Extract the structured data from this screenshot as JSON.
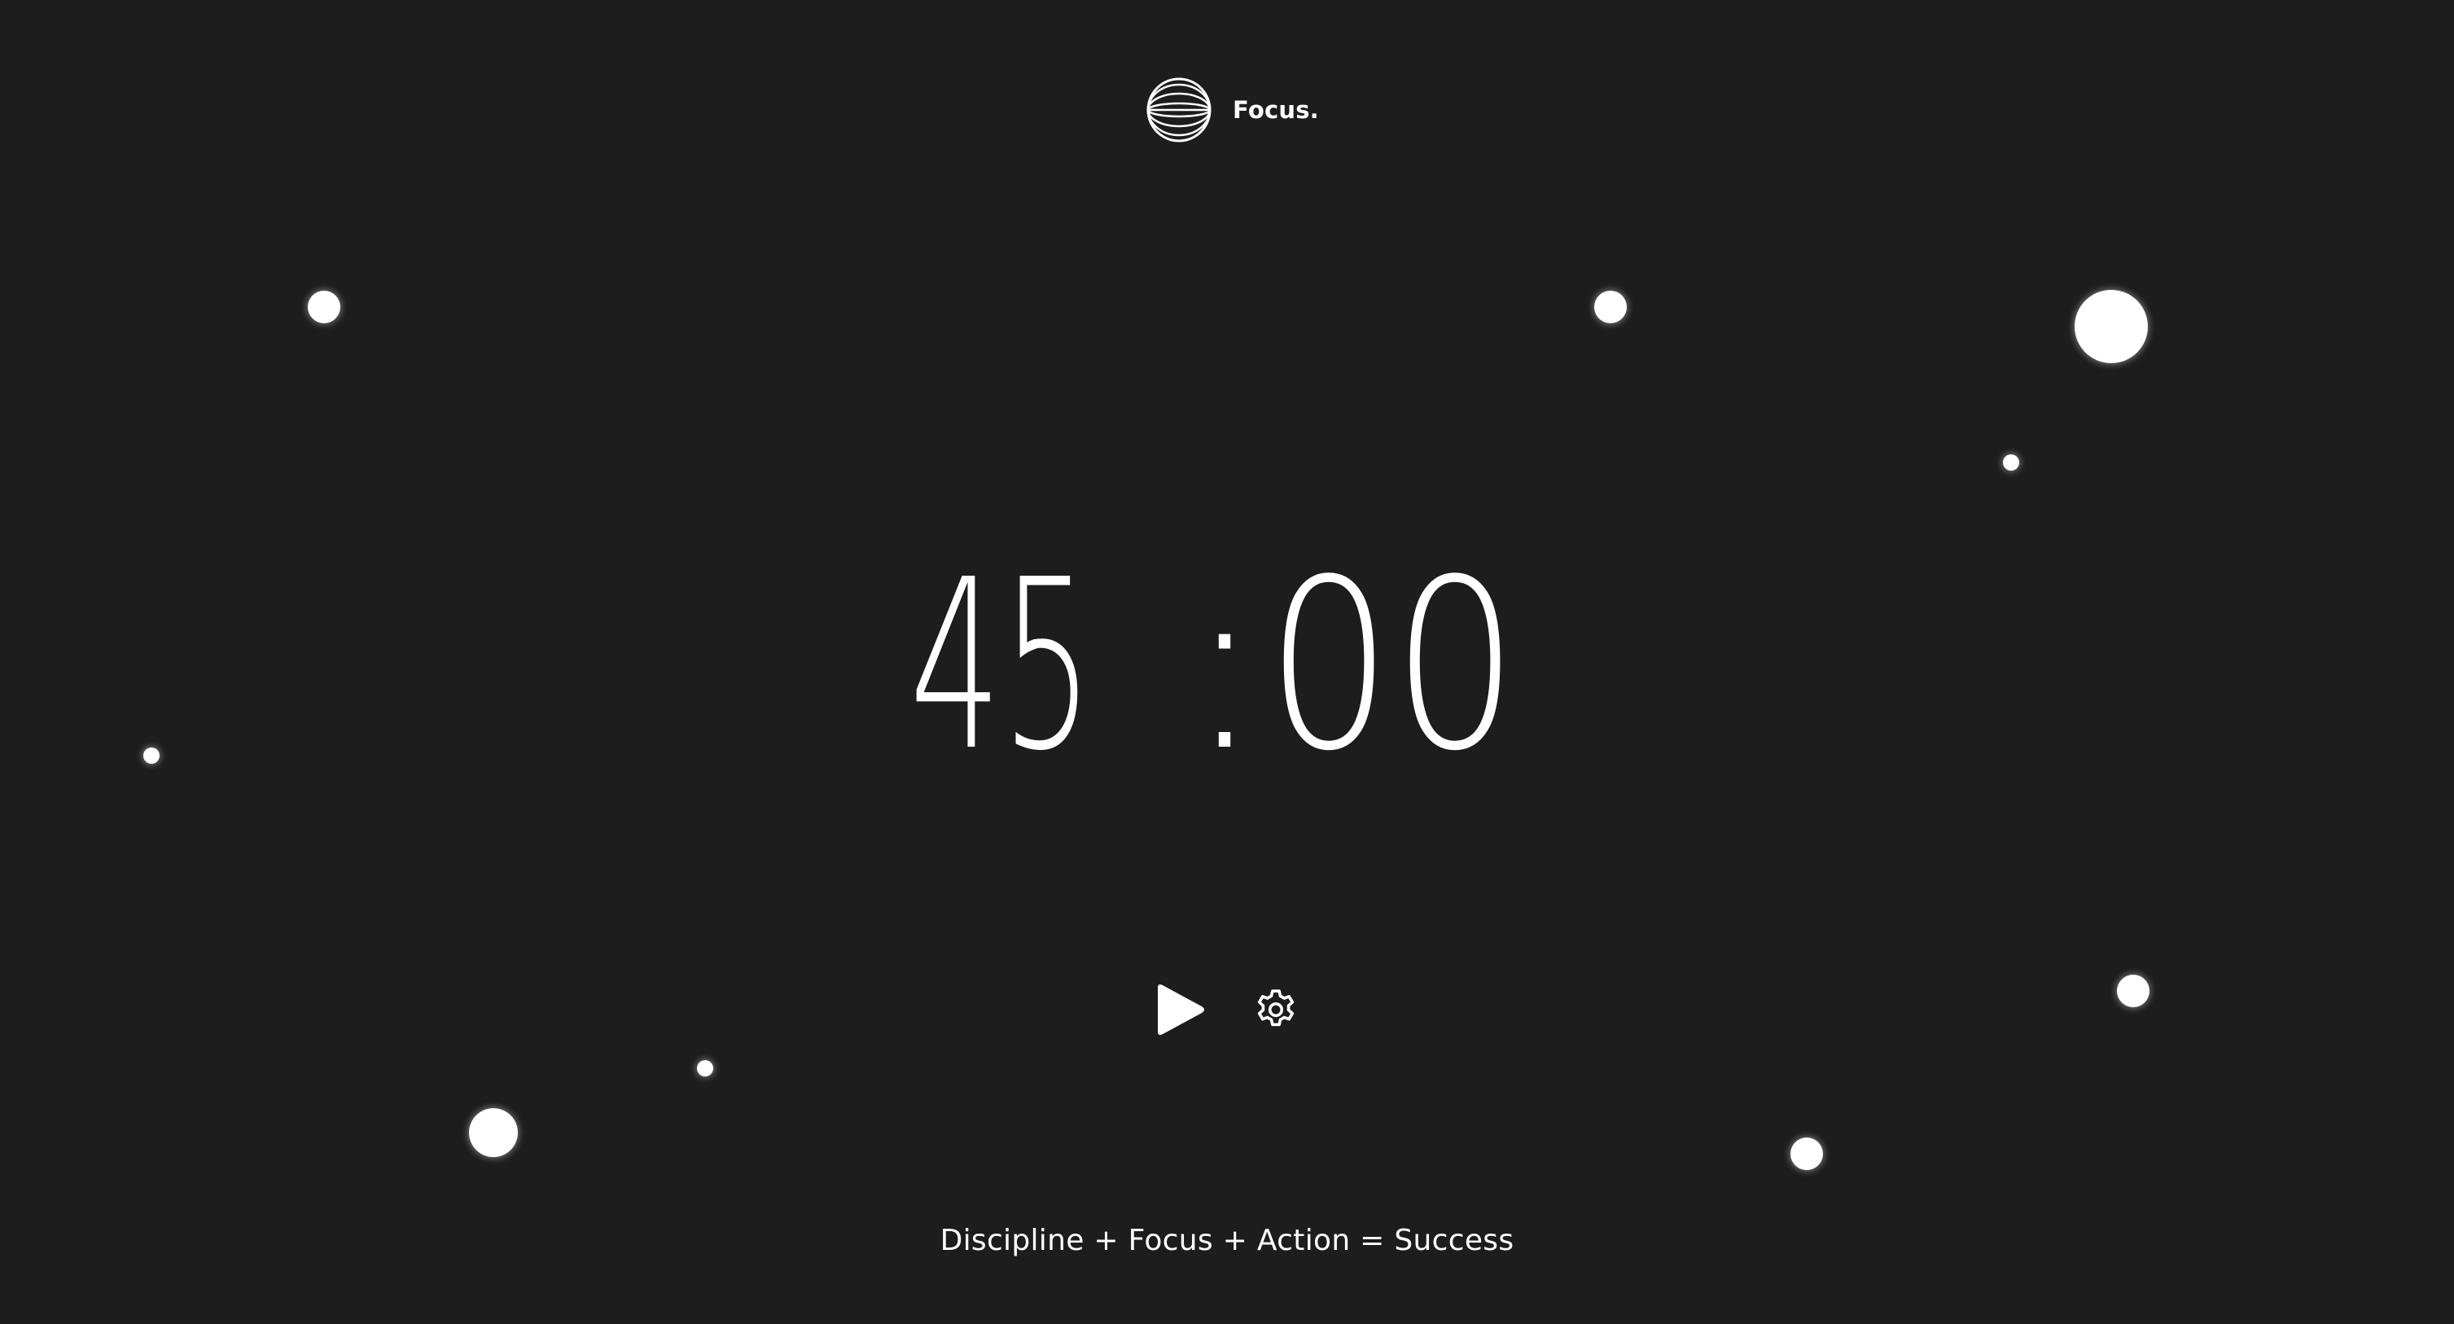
{
  "brand": {
    "name": "Focus.",
    "logo_icon": "globe-icon"
  },
  "timer": {
    "minutes": "45",
    "separator": ":",
    "seconds": "00"
  },
  "controls": {
    "play_icon": "play-icon",
    "settings_icon": "gear-icon"
  },
  "motto": "Discipline + Focus + Action = Success",
  "colors": {
    "background": "#1d1d1d",
    "foreground": "#ffffff"
  }
}
